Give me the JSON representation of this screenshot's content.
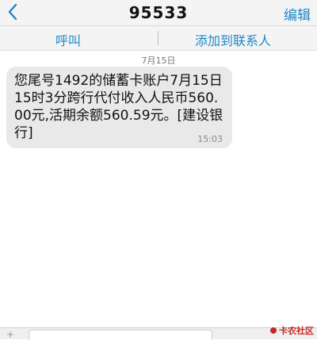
{
  "header": {
    "title": "95533",
    "edit_label": "编辑"
  },
  "actions": {
    "call_label": "呼叫",
    "add_contact_label": "添加到联系人"
  },
  "thread": {
    "date": "7月15日",
    "messages": [
      {
        "text": "您尾号1492的储蓄卡账户7月15日15时3分跨行代付收入人民币560.00元,活期余额560.59元。[建设银行]",
        "time": "15:03"
      }
    ]
  },
  "watermark": {
    "text": "卡农社区"
  },
  "colors": {
    "accent": "#1e88c9",
    "bubble": "#e9e9e9",
    "watermark": "#c62828"
  },
  "icons": [
    "back-arrow-icon",
    "watermark-logo-icon"
  ]
}
